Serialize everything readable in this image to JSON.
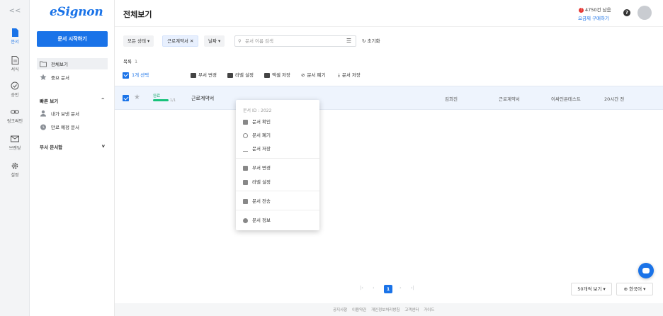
{
  "rail": {
    "collapse": "<<",
    "items": [
      {
        "label": "문서",
        "icon": "document-icon",
        "active": true
      },
      {
        "label": "서식",
        "icon": "template-icon",
        "active": false
      },
      {
        "label": "승인",
        "icon": "check-circle-icon",
        "active": false
      },
      {
        "label": "링크써인",
        "icon": "link-icon",
        "active": false
      },
      {
        "label": "브랜딩",
        "icon": "mail-icon",
        "active": false
      },
      {
        "label": "설정",
        "icon": "gear-icon",
        "active": false
      }
    ]
  },
  "sidebar": {
    "logo": "eSignon",
    "start_button": "문서 시작하기",
    "items": [
      {
        "label": "전체보기",
        "icon": "folder-icon"
      },
      {
        "label": "중요 문서",
        "icon": "star-icon"
      }
    ],
    "quick_view": {
      "title": "빠른 보기",
      "chevron": "^",
      "items": [
        {
          "label": "내가 보낸 문서",
          "icon": "person-icon"
        },
        {
          "label": "만료 예정 문서",
          "icon": "alarm-icon"
        }
      ]
    },
    "dept_docs": {
      "title": "부서 문서함",
      "chevron": "v"
    }
  },
  "header": {
    "title": "전체보기",
    "remain_text": "4750건 남음",
    "alert_glyph": "!",
    "buy_link": "요금제 구매하기",
    "help": "?"
  },
  "filters": {
    "status": "모든 상태 ▾",
    "chip": "근로계약서 ✕",
    "date": "날짜 ▾",
    "search_placeholder": "문서 이름 검색",
    "filter_glyph": "☰",
    "reset": "↻ 초기화"
  },
  "list": {
    "count_label": "목록",
    "count_value": "1"
  },
  "actions": {
    "selected": "1개 선택",
    "items": [
      "부서 변경",
      "라벨 설정",
      "엑셀 저장",
      "문서 폐기",
      "문서 저장"
    ]
  },
  "document": {
    "status": "완료",
    "progress": 1.0,
    "progress_text": "1/1",
    "name": "근로계약서",
    "sender": "김희진",
    "type": "근로계약서",
    "team": "이싸인온테스트",
    "time": "20시간 전",
    "star": "★"
  },
  "context_menu": {
    "doc_id": "문서 ID : 2022",
    "group1": [
      "문서 확인",
      "문서 폐기",
      "문서 저장"
    ],
    "group2": [
      "부서 변경",
      "라벨 설정"
    ],
    "group3": [
      "문서 전송"
    ],
    "group4": [
      "문서 정보"
    ]
  },
  "pagination": {
    "first": "|‹",
    "prev": "‹",
    "current": "1",
    "next": "›",
    "last": "›|"
  },
  "per_page": "50개씩 보기 ▾",
  "language": "⊕ 한국어 ▾",
  "footer": {
    "links": [
      "공지사항",
      "이용약관",
      "개인정보처리방침",
      "고객센터",
      "가이드"
    ]
  },
  "colors": {
    "accent": "#1a73e8",
    "success": "#18c27b",
    "alert": "#e53935"
  }
}
